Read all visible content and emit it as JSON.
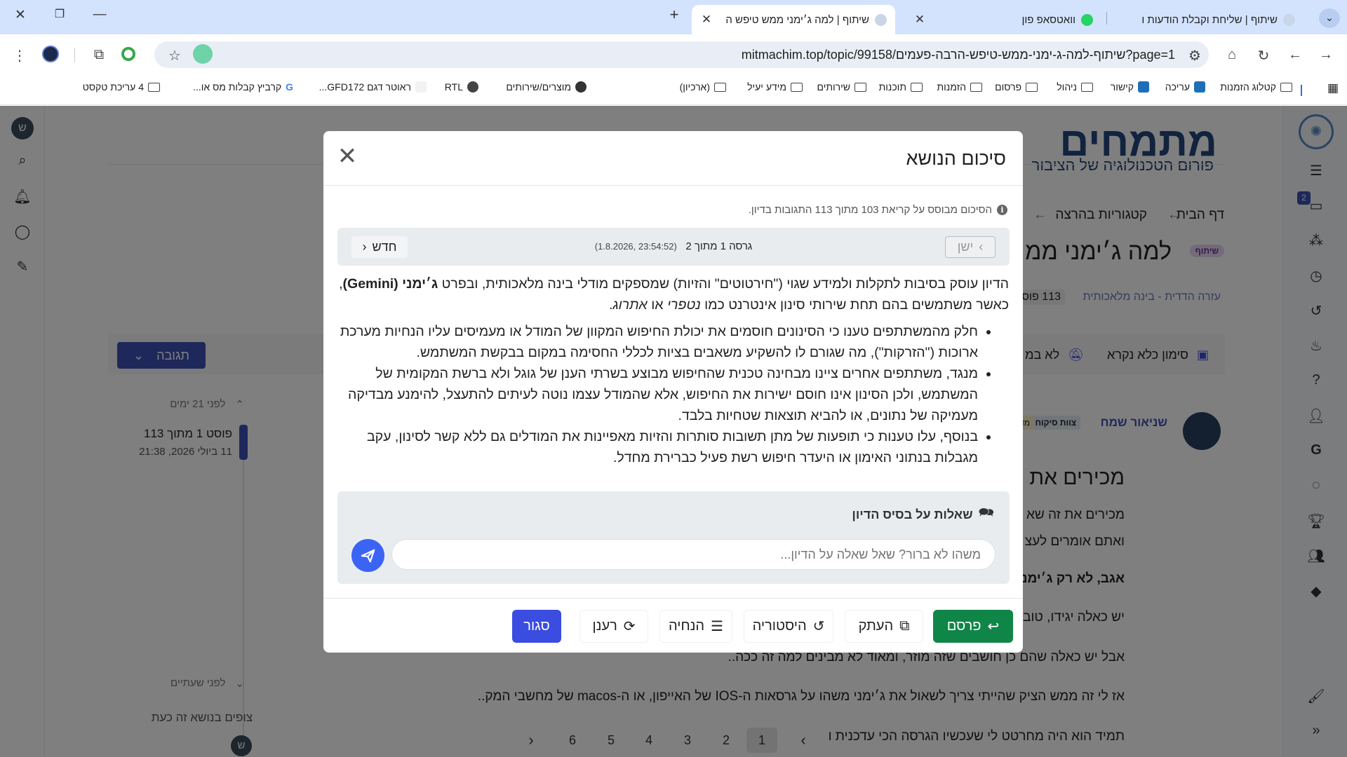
{
  "browser": {
    "tabs": [
      {
        "title": "שיתוף | למה ג׳ימני ממש טיפש ה",
        "active": true
      },
      {
        "title": "וואטסאפ פון",
        "active": false
      },
      {
        "title": "שיתוף | שליחת וקבלת הודעות ו",
        "active": false
      }
    ],
    "url": "mitmachim.top/topic/99158/שיתוף-למה-ג-ימני-ממש-טיפש-הרבה-פעמים?page=1",
    "bookmarks": [
      "קטלוג הזמנות",
      "עריכה",
      "קישור",
      "ניהול",
      "פרסום",
      "הזמנות",
      "תוכנות",
      "שירותים",
      "מידע יעיל",
      "(ארכיון)",
      "מוצרים/שירותים",
      "RTL",
      "ראוטר דגם GFD172...",
      "קרביץ קבלות מס או...",
      "4 עריכת טקסט"
    ]
  },
  "page": {
    "breadcrumb_home": "דף הבית",
    "breadcrumb_categories": "קטגוריות בהרצה",
    "topic_title_partial": "למה ג׳ימני ממ",
    "topic_badge": "שיתוף",
    "category_link": "עזרה הדדית - בינה מלאכותית",
    "posts_count_partial": "113 פוס",
    "mark_unread": "סימון כלא נקרא",
    "not_watching_partial": "לא במ",
    "reply_button": "תגובה",
    "timeline": {
      "ago_top": "לפני 21 ימים",
      "post_position": "פוסט 1 מתוך 113",
      "post_date": "11 ביולי 2026, 21:38",
      "ago_bottom": "לפני שעתיים",
      "viewing_now": "צופים בנושא זה כעת"
    },
    "author": "שניאור שמח",
    "author_badge_1": "צוות סיקוח",
    "author_badge_2": "מדר",
    "post_heading_partial": "מכירים את",
    "post_lines": [
      "מכירים את זה שא",
      "ואתם אומרים לעצ",
      "אגב, לא רק ג׳ימני",
      "יש כאלה יגידו, טוב",
      "אבל יש כאלה שהם כן חושבים שזה מוזר, ומאוד לא מבינים למה זה ככה..",
      "אז לי זה ממש הציק שהייתי צריך לשאול את ג׳ימני משהו על גרסאות ה-IOS של האייפון, או ה-macos של מחשבי המק..",
      "תמיד הוא היה מחרטט לי שעכשיו הגרסה הכי עדכנית ו"
    ],
    "pagination": [
      "1",
      "2",
      "3",
      "4",
      "5",
      "6"
    ],
    "pagination_current": "1",
    "logo_name": "מתמחים",
    "logo_tagline": "פורום הטכנולוגיה של הציבור",
    "notif_count": "2"
  },
  "modal": {
    "title": "סיכום הנושא",
    "info": "הסיכום מבוסס על קריאת 103 מתוך 113 התגובות בדיון.",
    "old_label": "ישן",
    "new_label": "חדש",
    "version": "גרסה 1 מתוך 2",
    "version_time": "(23:54:52 ,1.8.2026)",
    "summary_intro_1": "הדיון עוסק בסיבות לתקלות ולמידע שגוי (\"חירטוטים\" והזיות) שמספקים מודלי בינה מלאכותית, ובפרט ",
    "summary_intro_bold": "ג׳ימני (Gemini)",
    "summary_intro_2": ", כאשר משתמשים בהם תחת שירותי סינון אינטרנט כמו ",
    "summary_intro_it1": "נטפרי",
    "summary_intro_or": " או ",
    "summary_intro_it2": "אתרוג",
    "summary_intro_end": ".",
    "bullets": [
      "חלק מהמשתתפים טענו כי הסינונים חוסמים את יכולת החיפוש המקוון של המודל או מעמיסים עליו הנחיות מערכת ארוכות (\"הזרקות\"), מה שגורם לו להשקיע משאבים בציות לכללי החסימה במקום בבקשת המשתמש.",
      "מנגד, משתתפים אחרים ציינו מבחינה טכנית שהחיפוש מבוצע בשרתי הענן של גוגל ולא ברשת המקומית של המשתמש, ולכן הסינון אינו חוסם ישירות את החיפוש, אלא שהמודל עצמו נוטה לעיתים להתעצל, להימנע מבדיקה מעמיקה של נתונים, או להביא תוצאות שטחיות בלבד.",
      "בנוסף, עלו טענות כי תופעות של מתן תשובות סותרות והזיות מאפיינות את המודלים גם ללא קשר לסינון, עקב מגבלות בנתוני האימון או היעדר חיפוש רשת פעיל כברירת מחדל."
    ],
    "qa_title": "שאלות על בסיס הדיון",
    "qa_placeholder": "משהו לא ברור? שאל שאלה על הדיון...",
    "buttons": {
      "publish": "פרסם",
      "copy": "העתק",
      "history": "היסטוריה",
      "instructions": "הנחיה",
      "refresh": "רענן",
      "close": "סגור"
    }
  },
  "colors": {
    "tabbar": "#d3e3fd",
    "publish": "#108548",
    "close": "#3b4ce0",
    "send": "#3b64f5",
    "reply": "#3f51b5",
    "logo": "#24477f"
  }
}
